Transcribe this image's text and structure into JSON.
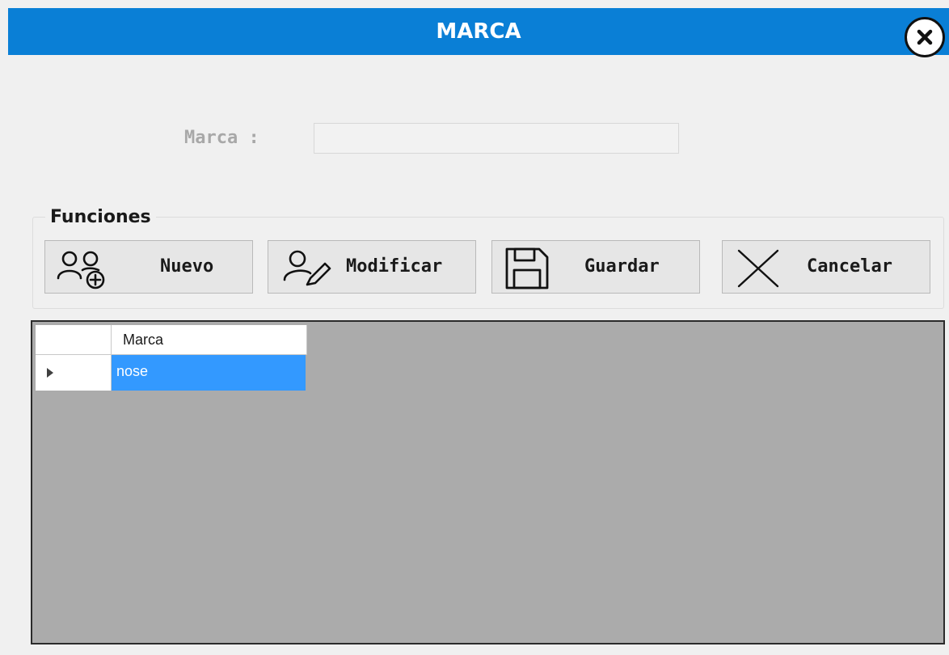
{
  "window": {
    "title": "MARCA",
    "accent_color": "#0a7fd6",
    "close_icon": "close-icon"
  },
  "form": {
    "marca_label": "Marca :",
    "marca_value": ""
  },
  "functions": {
    "group_title": "Funciones",
    "buttons": [
      {
        "label": "Nuevo",
        "icon": "add-users-icon"
      },
      {
        "label": "Modificar",
        "icon": "edit-user-icon"
      },
      {
        "label": "Guardar",
        "icon": "floppy-disk-icon"
      },
      {
        "label": "Cancelar",
        "icon": "cancel-x-icon"
      }
    ]
  },
  "grid": {
    "columns": [
      "Marca"
    ],
    "rows": [
      {
        "marca": "nose",
        "selected": true
      }
    ],
    "selection_color": "#3399ff"
  }
}
